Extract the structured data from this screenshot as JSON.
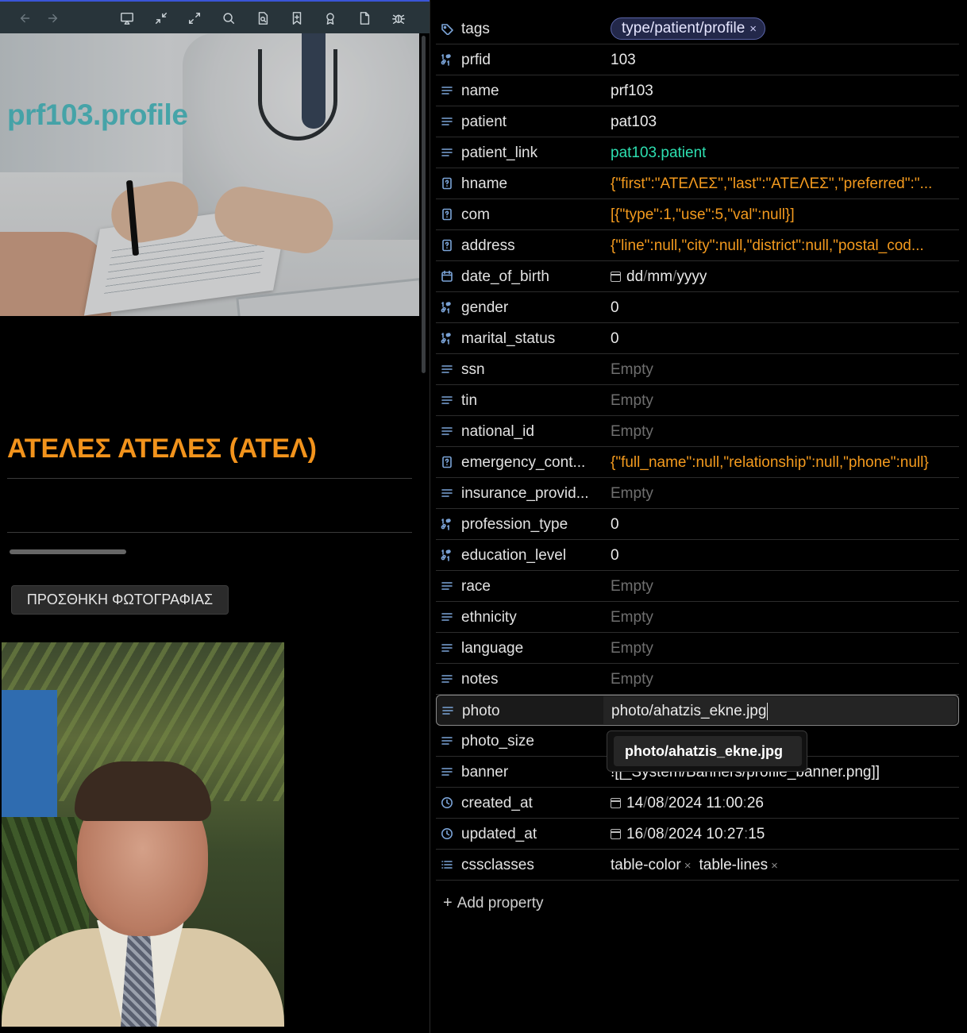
{
  "toolbar": {
    "icons": [
      "back-arrow-icon",
      "forward-arrow-icon",
      "cast-icon",
      "collapse-icon",
      "expand-icon",
      "search-icon",
      "file-search-icon",
      "bookmark-icon",
      "badge-icon",
      "page-icon",
      "bug-icon"
    ]
  },
  "banner": {
    "title": "prf103.profile"
  },
  "profile": {
    "heading": "ΑΤΕΛΕΣ ΑΤΕΛΕΣ (ΑΤΕΛ)",
    "add_photo_label": "ΠΡΟΣΘΗΚΗ ΦΩΤΟΓΡΑΦΙΑΣ"
  },
  "properties": [
    {
      "key": "tags",
      "icon": "tag-icon",
      "type": "tag",
      "value": "type/patient/profile"
    },
    {
      "key": "prfid",
      "icon": "number-icon",
      "type": "text",
      "value": "103"
    },
    {
      "key": "name",
      "icon": "text-icon",
      "type": "text",
      "value": "prf103"
    },
    {
      "key": "patient",
      "icon": "text-icon",
      "type": "text",
      "value": "pat103"
    },
    {
      "key": "patient_link",
      "icon": "text-icon",
      "type": "link",
      "value": "pat103.patient"
    },
    {
      "key": "hname",
      "icon": "unknown-icon",
      "type": "json",
      "value": "{\"first\":\"ΑΤΕΛΕΣ\",\"last\":\"ΑΤΕΛΕΣ\",\"preferred\":\"..."
    },
    {
      "key": "com",
      "icon": "unknown-icon",
      "type": "json",
      "value": "[{\"type\":1,\"use\":5,\"val\":null}]"
    },
    {
      "key": "address",
      "icon": "unknown-icon",
      "type": "json",
      "value": "{\"line\":null,\"city\":null,\"district\":null,\"postal_cod..."
    },
    {
      "key": "date_of_birth",
      "icon": "calendar-icon",
      "type": "date",
      "value": "dd/mm/yyyy"
    },
    {
      "key": "gender",
      "icon": "number-icon",
      "type": "text",
      "value": "0"
    },
    {
      "key": "marital_status",
      "icon": "number-icon",
      "type": "text",
      "value": "0"
    },
    {
      "key": "ssn",
      "icon": "text-icon",
      "type": "empty",
      "value": "Empty"
    },
    {
      "key": "tin",
      "icon": "text-icon",
      "type": "empty",
      "value": "Empty"
    },
    {
      "key": "national_id",
      "icon": "text-icon",
      "type": "empty",
      "value": "Empty"
    },
    {
      "key": "emergency_cont...",
      "icon": "unknown-icon",
      "type": "json",
      "value": "{\"full_name\":null,\"relationship\":null,\"phone\":null}"
    },
    {
      "key": "insurance_provid...",
      "icon": "text-icon",
      "type": "empty",
      "value": "Empty"
    },
    {
      "key": "profession_type",
      "icon": "number-icon",
      "type": "text",
      "value": "0"
    },
    {
      "key": "education_level",
      "icon": "number-icon",
      "type": "text",
      "value": "0"
    },
    {
      "key": "race",
      "icon": "text-icon",
      "type": "empty",
      "value": "Empty"
    },
    {
      "key": "ethnicity",
      "icon": "text-icon",
      "type": "empty",
      "value": "Empty"
    },
    {
      "key": "language",
      "icon": "text-icon",
      "type": "empty",
      "value": "Empty"
    },
    {
      "key": "notes",
      "icon": "text-icon",
      "type": "empty",
      "value": "Empty"
    },
    {
      "key": "photo",
      "icon": "text-icon",
      "type": "editing",
      "value": "photo/ahatzis_ekne.jpg"
    },
    {
      "key": "photo_size",
      "icon": "text-icon",
      "type": "text",
      "value": ""
    },
    {
      "key": "banner",
      "icon": "text-icon",
      "type": "text",
      "value": "![[_System/Banners/profile_banner.png]]"
    },
    {
      "key": "created_at",
      "icon": "clock-icon",
      "type": "datetime",
      "value": "14/08/2024 11:00:26"
    },
    {
      "key": "updated_at",
      "icon": "clock-icon",
      "type": "datetime",
      "value": "16/08/2024 10:27:15"
    },
    {
      "key": "cssclasses",
      "icon": "list-icon",
      "type": "chips",
      "value": [
        "table-color",
        "table-lines"
      ]
    }
  ],
  "suggestion": "photo/ahatzis_ekne.jpg",
  "add_property_label": "Add property"
}
